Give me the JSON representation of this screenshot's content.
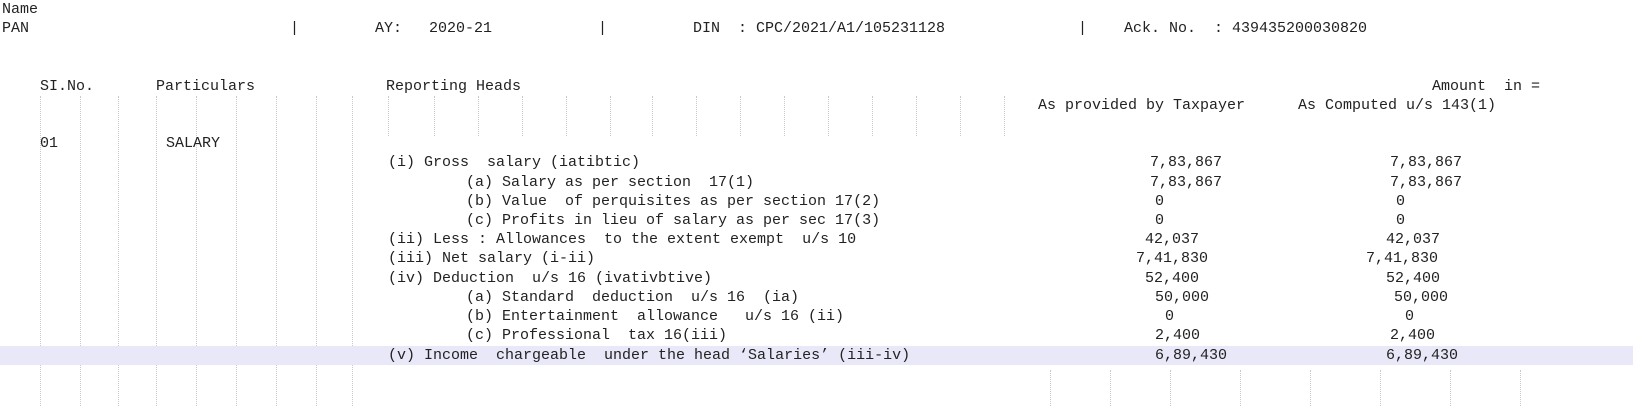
{
  "header": {
    "name_label": "Name",
    "pan_label": "PAN",
    "sep": "|",
    "ay": "AY:   2020-21",
    "din": "DIN  : CPC/2021/A1/105231128",
    "ack": "Ack. No.  : 439435200030820"
  },
  "columns": {
    "slno": "SI.No.",
    "particulars": "Particulars",
    "reporting": "Reporting Heads",
    "amount": "Amount  in =",
    "taxpayer": "As provided by Taxpayer",
    "computed": "As Computed u/s 143(1)"
  },
  "section": {
    "no": "01",
    "title": "SALARY"
  },
  "rows": [
    {
      "label": "(i) Gross  salary (iatibtic)",
      "taxpayer": "7,83,867",
      "computed": "7,83,867"
    },
    {
      "label": "(a) Salary as per section  17(1)",
      "taxpayer": "7,83,867",
      "computed": "7,83,867"
    },
    {
      "label": "(b) Value  of perquisites as per section 17(2)",
      "taxpayer": "0",
      "computed": "0"
    },
    {
      "label": "(c) Profits in lieu of salary as per sec 17(3)",
      "taxpayer": "0",
      "computed": "0"
    },
    {
      "label": "(ii) Less : Allowances  to the extent exempt  u/s 10",
      "taxpayer": "42,037",
      "computed": "42,037"
    },
    {
      "label": "(iii) Net salary (i-ii)",
      "taxpayer": "7,41,830",
      "computed": "7,41,830"
    },
    {
      "label": "(iv) Deduction  u/s 16 (ivativbtive)",
      "taxpayer": "52,400",
      "computed": "52,400"
    },
    {
      "label": "(a) Standard  deduction  u/s 16  (ia)",
      "taxpayer": "50,000",
      "computed": "50,000"
    },
    {
      "label": "(b) Entertainment  allowance   u/s 16 (ii)",
      "taxpayer": "0",
      "computed": "0"
    },
    {
      "label": "(c) Professional  tax 16(iii)",
      "taxpayer": "2,400",
      "computed": "2,400"
    },
    {
      "label": "(v) Income  chargeable  under the head ‘Salaries’ (iii-iv)",
      "taxpayer": "6,89,430",
      "computed": "6,89,430"
    }
  ],
  "colors": {
    "highlight": "#e8e8f8",
    "gridline": "#c9c9c9"
  }
}
